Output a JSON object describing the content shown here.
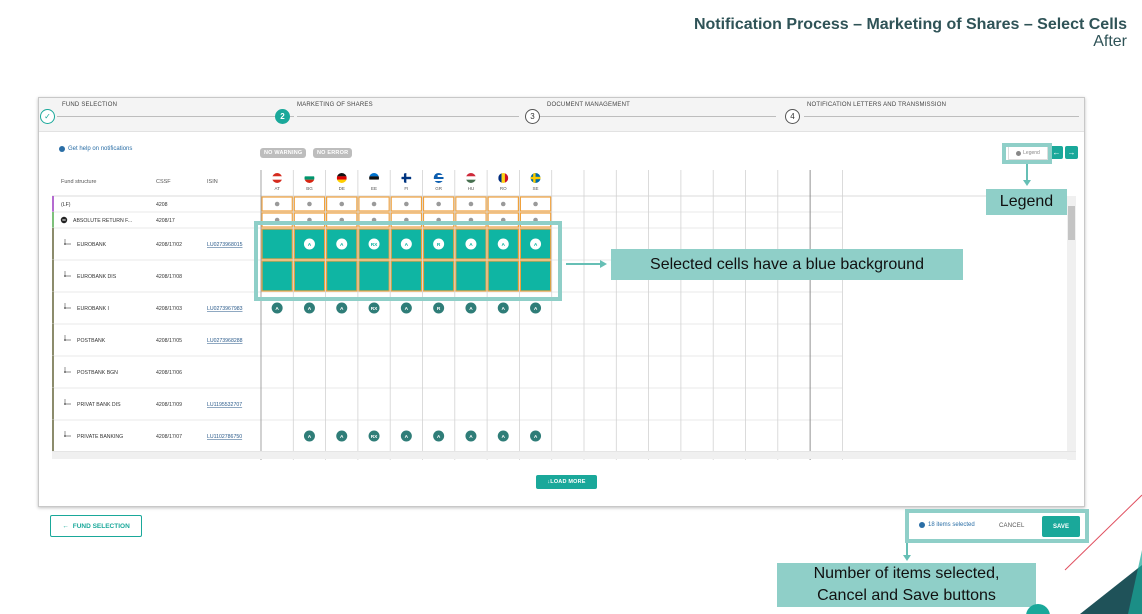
{
  "slide": {
    "title": "Notification Process – Marketing of Shares – Select Cells",
    "subtitle": "After"
  },
  "stepper": {
    "steps": [
      {
        "num": "✓",
        "label": "FUND SELECTION",
        "state": "done"
      },
      {
        "num": "2",
        "label": "MARKETING OF SHARES",
        "state": "active"
      },
      {
        "num": "3",
        "label": "DOCUMENT MANAGEMENT",
        "state": "todo"
      },
      {
        "num": "4",
        "label": "NOTIFICATION LETTERS AND TRANSMISSION",
        "state": "todo"
      }
    ]
  },
  "toolbar": {
    "help_link": "Get help on notifications",
    "no_warning": "NO WARNING",
    "no_error": "NO ERROR",
    "legend": "Legend",
    "prev_icon": "←",
    "next_icon": "→"
  },
  "grid": {
    "headers": {
      "fund": "Fund structure",
      "cssf": "CSSF",
      "isin": "ISIN"
    },
    "countries": [
      {
        "code": "AT",
        "flag": "austria"
      },
      {
        "code": "BG",
        "flag": "bulgaria"
      },
      {
        "code": "DE",
        "flag": "germany"
      },
      {
        "code": "EE",
        "flag": "estonia"
      },
      {
        "code": "FI",
        "flag": "finland"
      },
      {
        "code": "GR",
        "flag": "greece"
      },
      {
        "code": "HU",
        "flag": "hungary"
      },
      {
        "code": "RO",
        "flag": "romania"
      },
      {
        "code": "SE",
        "flag": "sweden"
      }
    ],
    "rows": [
      {
        "name": "(LF)",
        "cssf": "4208",
        "isin": "",
        "kind": "lf",
        "cells": [
          "s",
          "s",
          "s",
          "s",
          "s",
          "s",
          "s",
          "s",
          "s"
        ],
        "selected": false
      },
      {
        "name": "ABSOLUTE RETURN F...",
        "cssf": "4208/17",
        "isin": "",
        "kind": "sub",
        "cells": [
          "s",
          "s",
          "s",
          "s",
          "s",
          "s",
          "s",
          "s",
          "s"
        ],
        "selected": false
      },
      {
        "name": "EUROBANK",
        "cssf": "4208/17/02",
        "isin": "LU0273968015",
        "kind": "share",
        "cells": [
          "",
          "A",
          "A",
          "RX",
          "A",
          "R",
          "A",
          "A",
          "A"
        ],
        "selected": true
      },
      {
        "name": "EUROBANK DIS",
        "cssf": "4208/17/08",
        "isin": "",
        "kind": "share",
        "cells": [
          "",
          "",
          "",
          "",
          "",
          "",
          "",
          "",
          ""
        ],
        "selected": true
      },
      {
        "name": "EUROBANK I",
        "cssf": "4208/17/03",
        "isin": "LU0273967983",
        "kind": "share",
        "cells": [
          "A",
          "A",
          "A",
          "RX",
          "A",
          "R",
          "A",
          "A",
          "A"
        ],
        "selected": false
      },
      {
        "name": "POSTBANK",
        "cssf": "4208/17/05",
        "isin": "LU0273968288",
        "kind": "share",
        "cells": [
          "",
          "",
          "",
          "",
          "",
          "",
          "",
          "",
          ""
        ],
        "selected": false
      },
      {
        "name": "POSTBANK BGN",
        "cssf": "4208/17/06",
        "isin": "",
        "kind": "share",
        "cells": [
          "",
          "",
          "",
          "",
          "",
          "",
          "",
          "",
          ""
        ],
        "selected": false
      },
      {
        "name": "PRIVAT BANK DIS",
        "cssf": "4208/17/09",
        "isin": "LU1195532707",
        "kind": "share",
        "cells": [
          "",
          "",
          "",
          "",
          "",
          "",
          "",
          "",
          ""
        ],
        "selected": false
      },
      {
        "name": "PRIVATE BANKING",
        "cssf": "4208/17/07",
        "isin": "LU1102786750",
        "kind": "share",
        "cells": [
          "",
          "A",
          "A",
          "RX",
          "A",
          "A",
          "A",
          "A",
          "A"
        ],
        "selected": false
      }
    ]
  },
  "load_more": "LOAD MORE",
  "footer": {
    "fund_selection_btn": "FUND SELECTION",
    "items_selected": "18 items selected",
    "cancel": "CANCEL",
    "save": "SAVE"
  },
  "annotations": {
    "legend": "Legend",
    "selected_cells": "Selected cells have a blue background",
    "items_line1": "Number of items selected,",
    "items_line2": "Cancel and Save buttons"
  },
  "colors": {
    "teal": "#1aa89a",
    "dark_teal": "#2f7d78",
    "selected_bg": "#0fb5a3",
    "orange_outline": "#f0a13c",
    "annotation": "#8fcfc8"
  }
}
